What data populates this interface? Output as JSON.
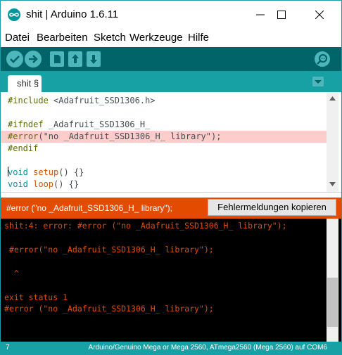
{
  "window": {
    "title": "shit | Arduino 1.6.11"
  },
  "menu": {
    "items": [
      {
        "label": "Datei"
      },
      {
        "label": "Bearbeiten"
      },
      {
        "label": "Sketch"
      },
      {
        "label": "Werkzeuge"
      },
      {
        "label": "Hilfe"
      }
    ]
  },
  "toolbar": {
    "buttons": [
      "check-icon",
      "arrow-right-icon",
      "new-file-icon",
      "open-arrow-up-icon",
      "save-arrow-down-icon"
    ],
    "serial_monitor": "magnifier-icon"
  },
  "tabs": [
    {
      "label": "shit §"
    }
  ],
  "editor": {
    "lines": [
      {
        "a": "#include ",
        "b": "<Adafruit_SSD1306.h>"
      },
      {
        "a": "",
        "b": ""
      },
      {
        "a": "#ifndef ",
        "b": "_Adafruit_SSD1306_H_"
      },
      {
        "a": "#error",
        "b": "(\"no _Adafruit_SSD1306_H_ library\");"
      },
      {
        "a": "#endif",
        "b": ""
      },
      {
        "a": "",
        "b": ""
      },
      {
        "a": "void",
        "b": " setup",
        "c": "() {}"
      },
      {
        "a": "void",
        "b": " loop",
        "c": "() {}"
      }
    ],
    "highlight_color": "#ffcccc"
  },
  "error_bar": {
    "message": "#error (\"no _Adafruit_SSD1306_H_ library\");",
    "copy_button": "Fehlermeldungen kopieren",
    "color": "#e34c00"
  },
  "console": {
    "lines": [
      "shit:4: error: #error (\"no _Adafruit_SSD1306_H_ library\");",
      "",
      " #error(\"no _Adafruit_SSD1306_H_ library\");",
      "",
      "  ^",
      "",
      "exit status 1",
      "#error (\"no _Adafruit_SSD1306_H_ library\");"
    ]
  },
  "status": {
    "line_number": "7",
    "board": "Arduino/Genuino Mega or Mega 2560, ATmega2560 (Mega 2560) auf COM6"
  },
  "colors": {
    "toolbar": "#006468",
    "accent": "#17a1a5",
    "button": "#4db7bb"
  }
}
